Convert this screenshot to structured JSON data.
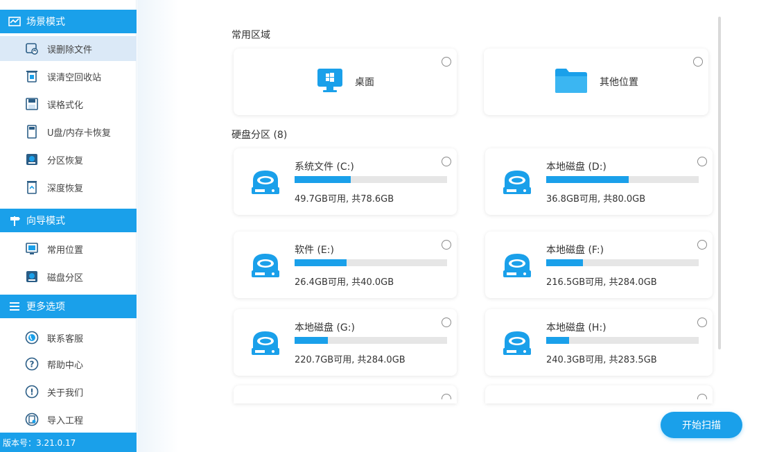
{
  "header": {
    "title": ""
  },
  "sidebar": {
    "scene_mode": {
      "title": "场景模式",
      "items": [
        {
          "label": "误删除文件",
          "icon": "file-recover-icon",
          "active": true
        },
        {
          "label": "误清空回收站",
          "icon": "recycle-bin-icon"
        },
        {
          "label": "误格式化",
          "icon": "format-disk-icon"
        },
        {
          "label": "U盘/内存卡恢复",
          "icon": "usb-card-icon"
        },
        {
          "label": "分区恢复",
          "icon": "partition-icon"
        },
        {
          "label": "深度恢复",
          "icon": "deep-recover-icon"
        }
      ]
    },
    "wizard_mode": {
      "title": "向导模式",
      "items": [
        {
          "label": "常用位置",
          "icon": "common-location-icon"
        },
        {
          "label": "磁盘分区",
          "icon": "disk-partition-icon"
        }
      ]
    },
    "more_options": {
      "title": "更多选项",
      "items": [
        {
          "label": "联系客服",
          "icon": "phone-icon"
        },
        {
          "label": "帮助中心",
          "icon": "help-icon"
        },
        {
          "label": "关于我们",
          "icon": "info-icon"
        },
        {
          "label": "导入工程",
          "icon": "import-icon"
        }
      ]
    },
    "version": "版本号：3.21.0.17"
  },
  "main": {
    "common_section": "常用区域",
    "locations": [
      {
        "label": "桌面",
        "icon": "desktop-icon"
      },
      {
        "label": "其他位置",
        "icon": "folder-icon"
      }
    ],
    "disk_section": "硬盘分区 (8)",
    "disks": [
      {
        "name": "系统文件 (C:)",
        "info": "49.7GB可用, 共78.6GB",
        "used_fraction": 0.37
      },
      {
        "name": "本地磁盘 (D:)",
        "info": "36.8GB可用, 共80.0GB",
        "used_fraction": 0.54
      },
      {
        "name": "软件 (E:)",
        "info": "26.4GB可用, 共40.0GB",
        "used_fraction": 0.34
      },
      {
        "name": "本地磁盘 (F:)",
        "info": "216.5GB可用, 共284.0GB",
        "used_fraction": 0.24
      },
      {
        "name": "本地磁盘 (G:)",
        "info": "220.7GB可用, 共284.0GB",
        "used_fraction": 0.22
      },
      {
        "name": "本地磁盘 (H:)",
        "info": "240.3GB可用, 共283.5GB",
        "used_fraction": 0.15
      }
    ],
    "scan_button": "开始扫描"
  },
  "colors": {
    "accent": "#1aa0ea",
    "active_bg": "#dbe9f7"
  }
}
